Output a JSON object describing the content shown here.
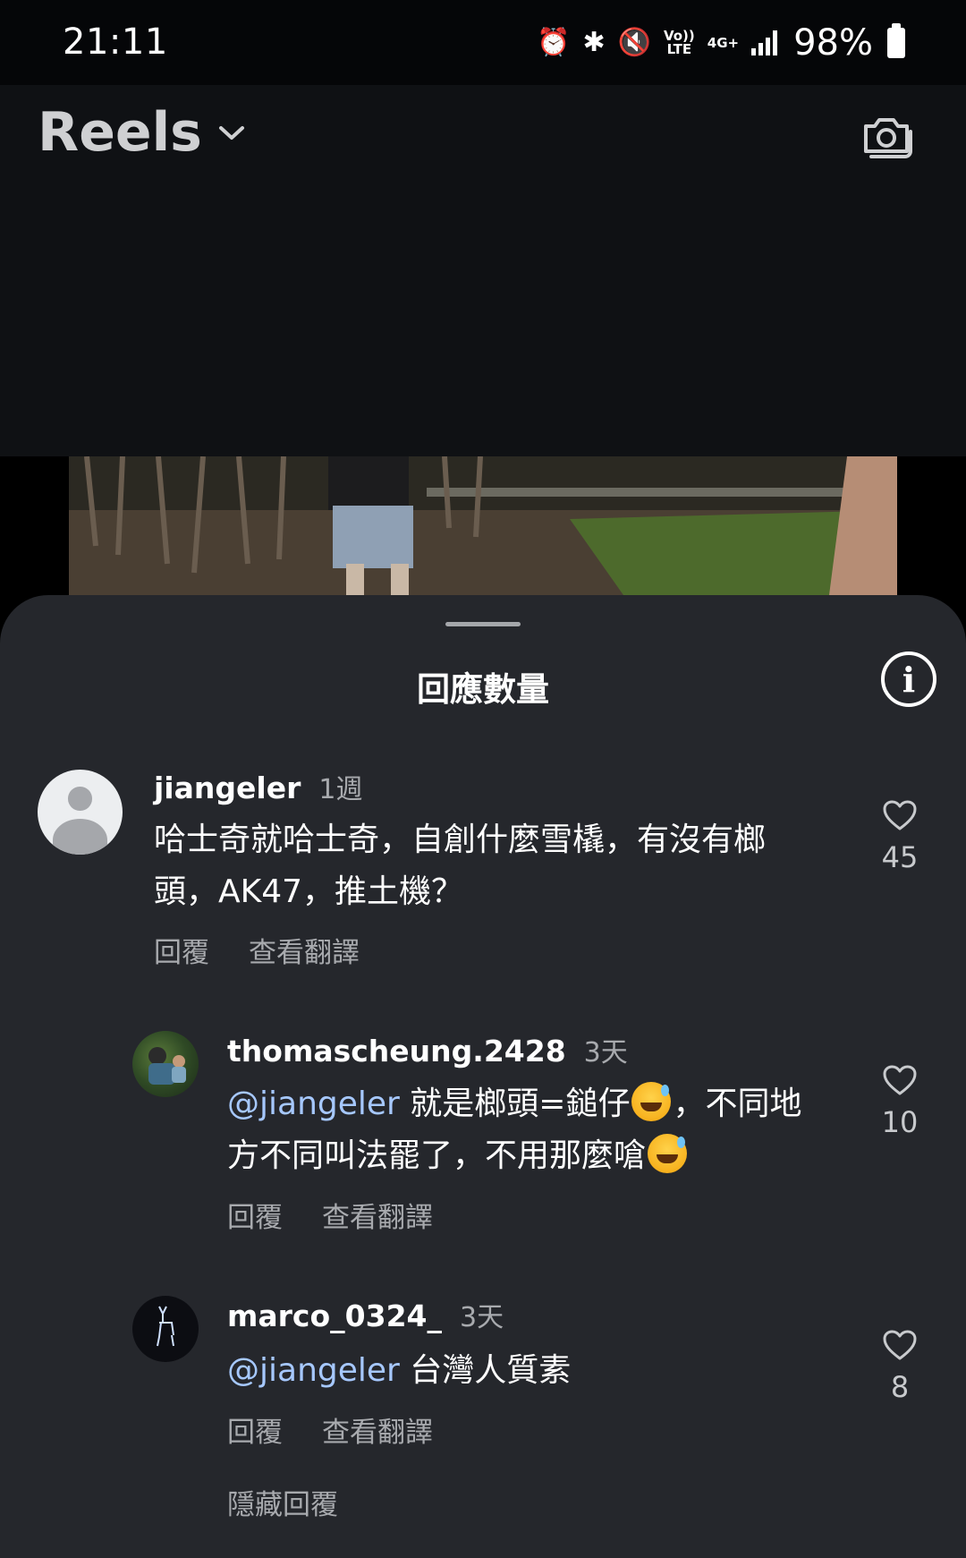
{
  "status_bar": {
    "time": "21:11",
    "volte_top": "Vo))",
    "volte_bottom": "LTE",
    "network": "4G+",
    "battery": "98%"
  },
  "header": {
    "title": "Reels",
    "icons": [
      "chevron-down-icon",
      "camera-icon"
    ]
  },
  "sheet": {
    "title": "回應數量",
    "info_icon": "info-icon",
    "hide_replies": "隱藏回覆"
  },
  "comments": [
    {
      "username": "jiangeler",
      "time": "1週",
      "text": "哈士奇就哈士奇，自創什麼雪橇，有沒有榔頭，AK47，推土機？",
      "reply_label": "回覆",
      "translate_label": "查看翻譯",
      "likes": "45"
    },
    {
      "username": "thomascheung.2428",
      "time": "3天",
      "mention": "@jiangeler",
      "text_part1": " 就是榔頭=鎚仔",
      "text_part2": "，不同地方不同叫法罷了，不用那麼嗆",
      "reply_label": "回覆",
      "translate_label": "查看翻譯",
      "likes": "10"
    },
    {
      "username": "marco_0324_",
      "time": "3天",
      "mention": "@jiangeler",
      "text": " 台灣人質素",
      "reply_label": "回覆",
      "translate_label": "查看翻譯",
      "likes": "8"
    }
  ],
  "colors": {
    "sheet_bg": "#25272c",
    "mention": "#a6c8ff",
    "secondary_text": "#a8aaae"
  }
}
